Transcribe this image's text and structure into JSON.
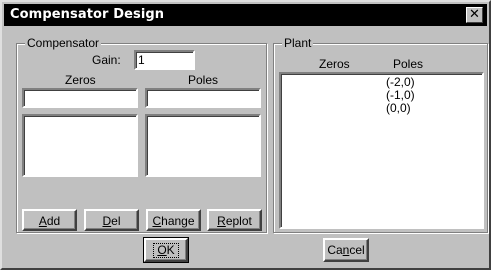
{
  "dialog": {
    "title": "Compensator Design",
    "close_glyph": "✕"
  },
  "compensator": {
    "group_label": "Compensator",
    "gain_label": "Gain:",
    "gain_value": "1",
    "zeros_header": "Zeros",
    "poles_header": "Poles",
    "zero_input_value": "",
    "pole_input_value": "",
    "zeros": [],
    "poles": [],
    "buttons": {
      "add": {
        "mnemonic": "A",
        "rest": "dd"
      },
      "del": {
        "mnemonic": "D",
        "rest": "el"
      },
      "change": {
        "mnemonic": "C",
        "rest": "hange"
      },
      "replot": {
        "mnemonic": "R",
        "rest": "eplot"
      }
    }
  },
  "plant": {
    "group_label": "Plant",
    "zeros_header": "Zeros",
    "poles_header": "Poles",
    "zeros": [],
    "poles": [
      "(-2,0)",
      "(-1,0)",
      "(0,0)"
    ]
  },
  "footer": {
    "ok": {
      "mnemonic": "O",
      "rest": "K"
    },
    "cancel": {
      "before": "Ca",
      "mnemonic": "n",
      "rest": "cel"
    }
  }
}
